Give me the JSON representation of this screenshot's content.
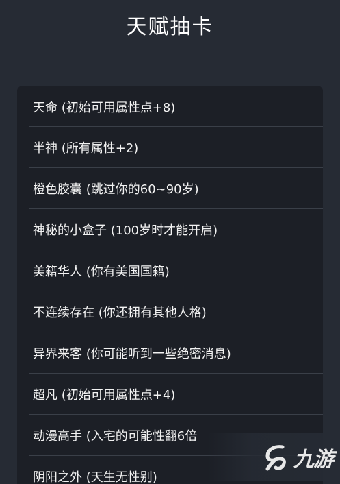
{
  "header": {
    "title": "天赋抽卡"
  },
  "talents": [
    "天命 (初始可用属性点+8)",
    "半神 (所有属性+2)",
    "橙色胶囊 (跳过你的60~90岁)",
    "神秘的小盒子 (100岁时才能开启)",
    "美籍华人 (你有美国国籍)",
    "不连续存在 (你还拥有其他人格)",
    "异界来客 (你可能听到一些绝密消息)",
    "超凡 (初始可用属性点+4)",
    "动漫高手 (入宅的可能性翻6倍",
    "阴阳之外 (天生无性别)"
  ],
  "watermark": {
    "text": "九游",
    "icon": "jiuyou-logo-icon"
  }
}
